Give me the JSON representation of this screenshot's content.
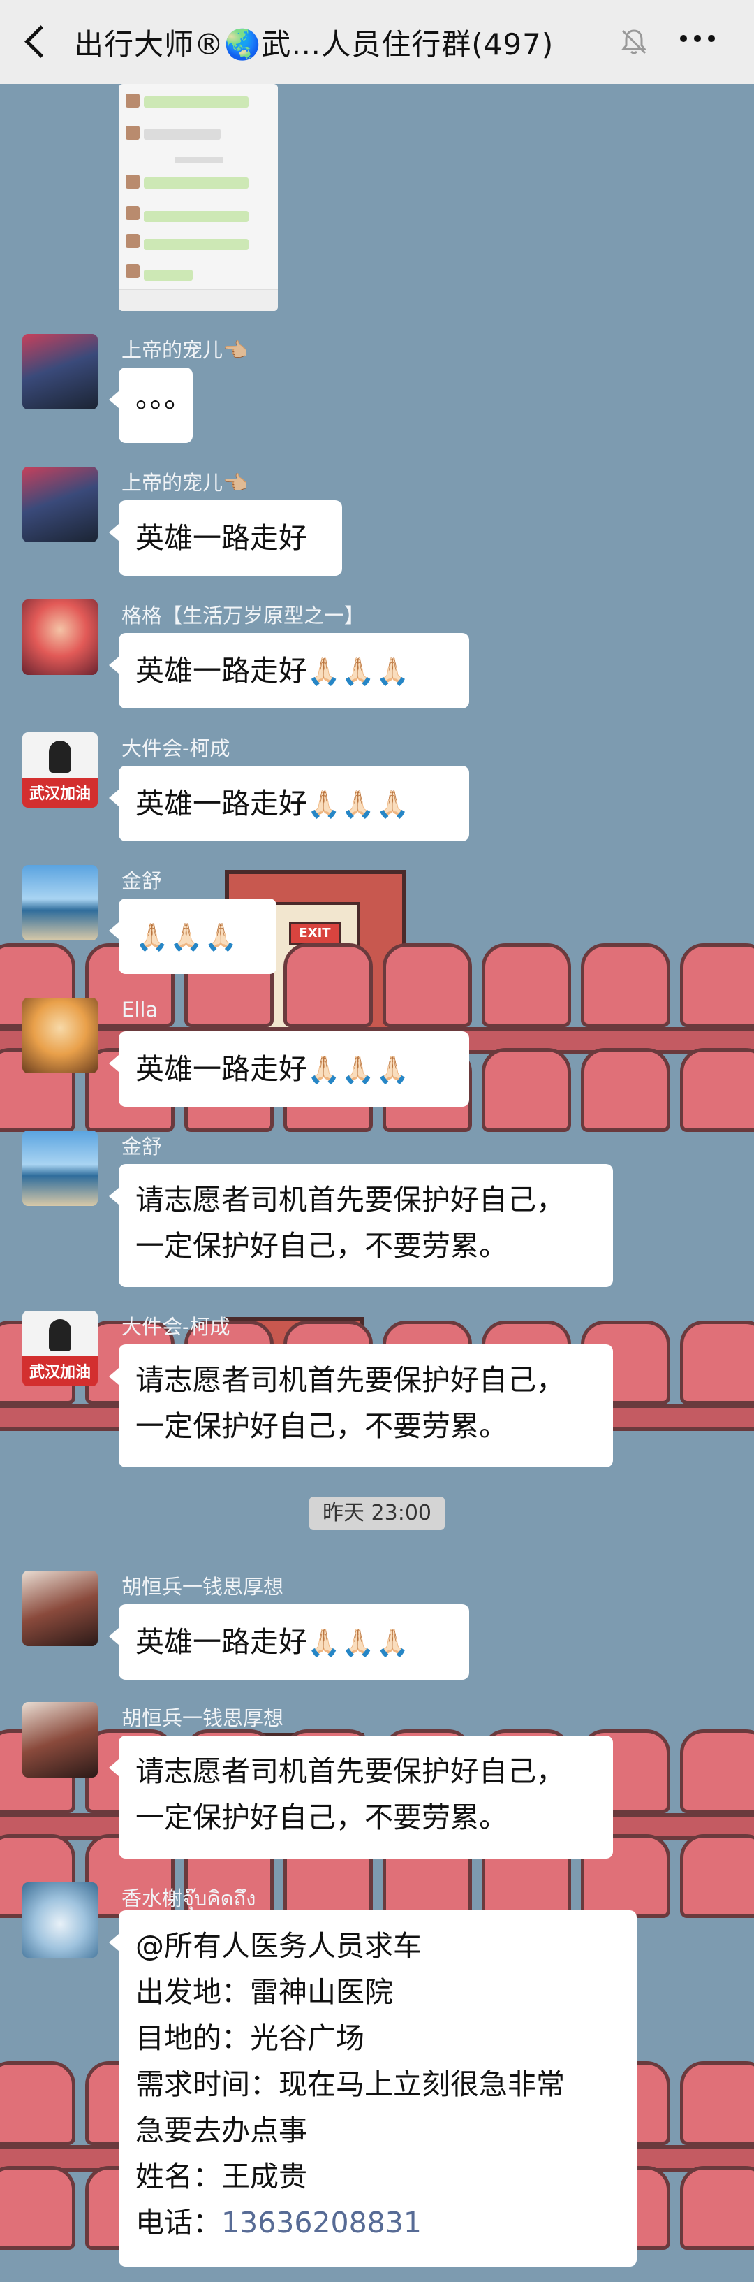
{
  "header": {
    "title": "出行大师®🌏武…人员住行群(497)"
  },
  "timestamp": "昨天 23:00",
  "wallpaper_exit_sign": "EXIT",
  "messages": [
    {
      "sender": "上帝的宠儿👈🏼",
      "text": "。。。"
    },
    {
      "sender": "上帝的宠儿👈🏼",
      "text": "英雄一路走好"
    },
    {
      "sender": "格格【生活万岁原型之一】",
      "text": "英雄一路走好",
      "emoji": "🙏🏻🙏🏻🙏🏻"
    },
    {
      "sender": "大件会-柯成",
      "text": "英雄一路走好",
      "emoji": "🙏🏻🙏🏻🙏🏻",
      "avatar_caption": "武汉加油"
    },
    {
      "sender": "金舒",
      "text": "",
      "emoji": "🙏🏻🙏🏻🙏🏻"
    },
    {
      "sender": "Ella",
      "text": "英雄一路走好",
      "emoji": "🙏🏻🙏🏻🙏🏻"
    },
    {
      "sender": "金舒",
      "line1": "请志愿者司机首先要保护好自己，",
      "line2": "一定保护好自己，不要劳累。"
    },
    {
      "sender": "大件会-柯成",
      "line1": "请志愿者司机首先要保护好自己，",
      "line2": "一定保护好自己，不要劳累。",
      "avatar_caption": "武汉加油"
    },
    {
      "sender": "胡恒兵一钱思厚想",
      "text": "英雄一路走好",
      "emoji": "🙏🏻🙏🏻🙏🏻"
    },
    {
      "sender": "胡恒兵一钱思厚想",
      "line1": "请志愿者司机首先要保护好自己，",
      "line2": "一定保护好自己，不要劳累。"
    },
    {
      "sender": "香水榭จุ๊บคิดถึง",
      "lines": [
        "@所有人医务人员求车",
        "出发地：雷神山医院",
        "目地的：光谷广场",
        "需求时间：现在马上立刻很急非常",
        "急要去办点事",
        "姓名：王成贵"
      ],
      "phone_label": "电话：",
      "phone": "13636208831"
    }
  ],
  "shot_lines": [
    "英雄一路走好🙏🏻🙏🏻🙏🏻",
    "一路走好🙏🏻🙏🏻",
    "英雄一路走好🙏🏻🙏🏻🙏🏻",
    "英雄一路走好🙏🏻🙏🏻🙏🏻",
    "英雄一路走好🙏🏻🙏🏻🙏🏻",
    "🙏🏻🙏🏻🙏🏻"
  ]
}
